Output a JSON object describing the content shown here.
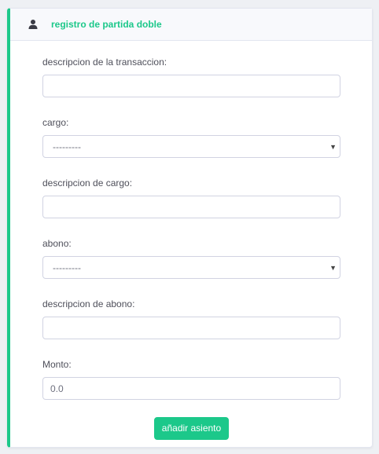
{
  "header": {
    "icon": "user-icon",
    "title": "registro de partida doble"
  },
  "form": {
    "transaction_description": {
      "label": "descripcion de la transaccion:",
      "value": ""
    },
    "cargo": {
      "label": "cargo:",
      "selected": "---------"
    },
    "cargo_description": {
      "label": "descripcion de cargo:",
      "value": ""
    },
    "abono": {
      "label": "abono:",
      "selected": "---------"
    },
    "abono_description": {
      "label": "descripcion de abono:",
      "value": ""
    },
    "monto": {
      "label": "Monto:",
      "value": "0.0"
    },
    "submit_label": "añadir asiento"
  },
  "colors": {
    "accent": "#1cc88a",
    "border": "#d1d3e2",
    "header_bg": "#f8f9fc"
  }
}
